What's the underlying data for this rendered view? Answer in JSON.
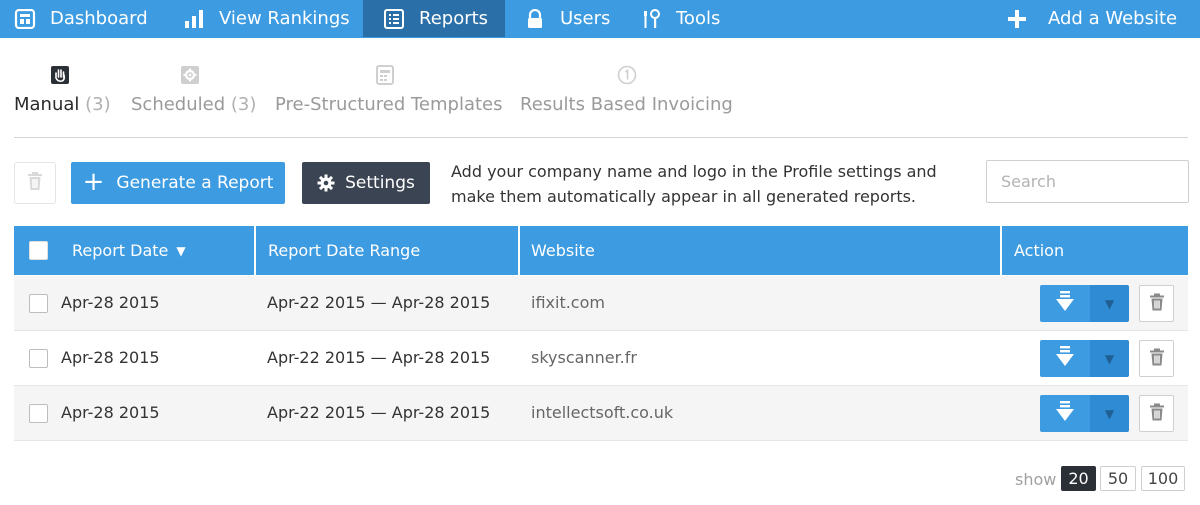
{
  "nav": {
    "items": [
      {
        "label": "Dashboard",
        "icon": "dashboard-icon"
      },
      {
        "label": "View Rankings",
        "icon": "bar-chart-icon"
      },
      {
        "label": "Reports",
        "icon": "report-list-icon",
        "active": true
      },
      {
        "label": "Users",
        "icon": "lock-icon"
      },
      {
        "label": "Tools",
        "icon": "tools-icon"
      }
    ],
    "add_website": "Add a Website"
  },
  "tabs": [
    {
      "label": "Manual",
      "count": "(3)",
      "icon": "hand-icon",
      "active": true
    },
    {
      "label": "Scheduled",
      "count": "(3)",
      "icon": "gear-icon"
    },
    {
      "label": "Pre-Structured Templates",
      "icon": "template-icon"
    },
    {
      "label": "Results Based Invoicing",
      "icon": "number-one-icon"
    }
  ],
  "toolbar": {
    "generate_label": "Generate a Report",
    "settings_label": "Settings",
    "info_text": "Add your company name and logo in the Profile settings and make them automatically appear in all generated reports.",
    "search_placeholder": "Search"
  },
  "table": {
    "columns": [
      "Report Date",
      "Report Date Range",
      "Website",
      "Action"
    ],
    "rows": [
      {
        "date": "Apr-28 2015",
        "range": "Apr-22 2015 — Apr-28 2015",
        "website": "ifixit.com"
      },
      {
        "date": "Apr-28 2015",
        "range": "Apr-22 2015 — Apr-28 2015",
        "website": "skyscanner.fr"
      },
      {
        "date": "Apr-28 2015",
        "range": "Apr-22 2015 — Apr-28 2015",
        "website": "intellectsoft.co.uk"
      }
    ]
  },
  "pager": {
    "label": "show",
    "options": [
      "20",
      "50",
      "100"
    ],
    "selected": "20"
  },
  "colors": {
    "primary": "#3d9be1",
    "nav_active": "#2a6fa8",
    "dark_button": "#3b4452"
  }
}
